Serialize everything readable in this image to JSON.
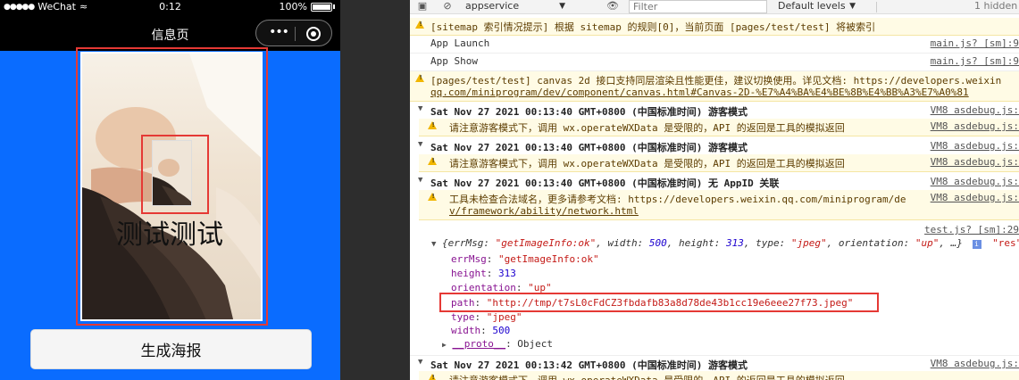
{
  "phone": {
    "status_dots": "●●●●●",
    "carrier": "WeChat",
    "wifi_glyph": "≈",
    "time": "0:12",
    "battery": "100%",
    "nav_title": "信息页",
    "capsule_more": "•••",
    "poster_text": "测试测试",
    "button_label": "生成海报"
  },
  "devtools": {
    "context": "appservice",
    "filter_placeholder": "Filter",
    "levels": "Default levels",
    "hidden": "1 hidden",
    "rows": [
      {
        "text": "[sitemap 索引情况提示] 根据 sitemap 的规则[0]，当前页面 [pages/test/test] 将被索引",
        "src": ""
      },
      {
        "text": "App Launch",
        "src": "main.js? [sm]:9"
      },
      {
        "text": "App Show",
        "src": "main.js? [sm]:9"
      },
      {
        "text": "[pages/test/test] canvas 2d 接口支持同层渲染且性能更佳，建议切换使用。详见文档: https://developers.weixin",
        "src": ""
      },
      {
        "text": "qq.com/miniprogram/dev/component/canvas.html#Canvas-2D-%E7%A4%BA%E4%BE%8B%E4%BB%A3%E7%A0%81",
        "src": ""
      }
    ],
    "groups": [
      {
        "title": "Sat Nov 27 2021 00:13:40 GMT+0800 (中国标准时间) 游客模式",
        "src": "VM8 asdebug.js:",
        "warn": "请注意游客模式下，调用 wx.operateWXData 是受限的，API 的返回是工具的模拟返回",
        "warn_src": "VM8 asdebug.js:"
      },
      {
        "title": "Sat Nov 27 2021 00:13:40 GMT+0800 (中国标准时间) 游客模式",
        "src": "VM8 asdebug.js:",
        "warn": "请注意游客模式下，调用 wx.operateWXData 是受限的，API 的返回是工具的模拟返回",
        "warn_src": "VM8 asdebug.js:"
      },
      {
        "title": "Sat Nov 27 2021 00:13:40 GMT+0800 (中国标准时间) 无 AppID 关联",
        "src": "VM8 asdebug.js:",
        "warn": "工具未检查合法域名，更多请参考文档: https://developers.weixin.qq.com/miniprogram/de",
        "warn2": "v/framework/ability/network.html",
        "warn_src": "VM8 asdebug.js:"
      }
    ],
    "obj_src": "test.js? [sm]:29",
    "obj_summary": {
      "open": "{errMsg: ",
      "errMsg": "\"getImageInfo:ok\"",
      "w_key": ", width: ",
      "w_val": "500",
      "h_key": ", height: ",
      "h_val": "313",
      "t_key": ", type: ",
      "t_val": "\"jpeg\"",
      "o_key": ", orientation: ",
      "o_val": "\"up\"",
      "close": ", …}",
      "info": "i",
      "res": "\"res\""
    },
    "props": [
      {
        "key": "errMsg",
        "val": "\"getImageInfo:ok\"",
        "kind": "s"
      },
      {
        "key": "height",
        "val": "313",
        "kind": "n"
      },
      {
        "key": "orientation",
        "val": "\"up\"",
        "kind": "s"
      },
      {
        "key": "path",
        "val": "\"http://tmp/t7sL0cFdCZ3fbdafb83a8d78de43b1cc19e6eee27f73.jpeg\"",
        "kind": "s"
      },
      {
        "key": "type",
        "val": "\"jpeg\"",
        "kind": "s"
      },
      {
        "key": "width",
        "val": "500",
        "kind": "n"
      }
    ],
    "proto_key": "__proto__",
    "proto_val": ": Object",
    "last_group": {
      "title": "Sat Nov 27 2021 00:13:42 GMT+0800 (中国标准时间) 游客模式",
      "src": "VM8 asdebug.js:",
      "warn": "请注意游客模式下，调用 wx.operateWXData 是受限的，API 的返回是工具的模拟返回"
    }
  }
}
